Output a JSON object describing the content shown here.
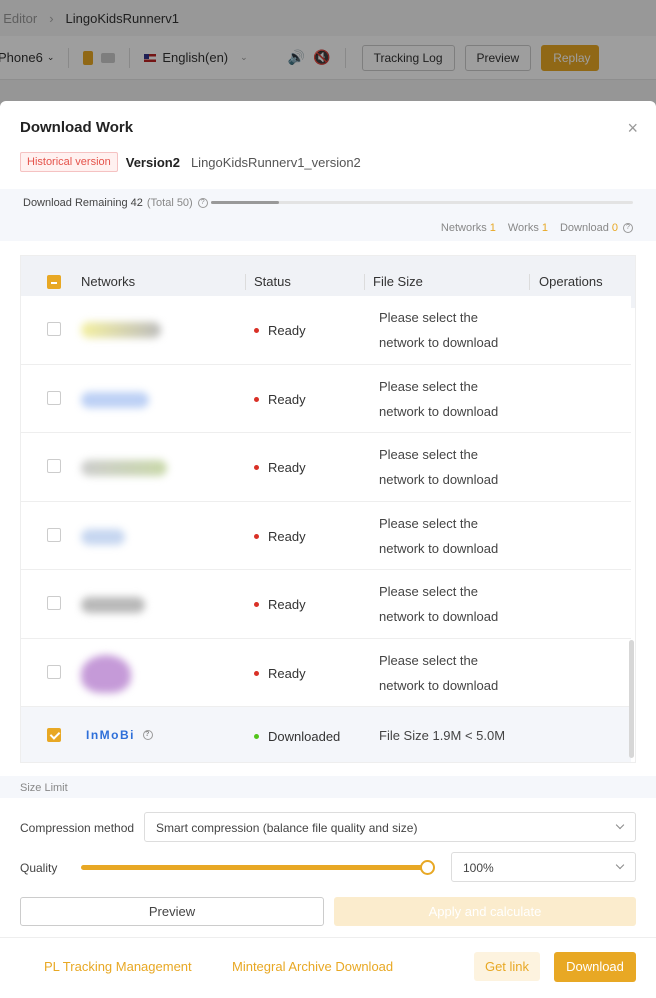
{
  "background": {
    "breadcrumb": {
      "prev": "t Editor",
      "current": "LingoKidsRunnerv1"
    },
    "device": "Phone6",
    "language": "English(en)",
    "buttons": {
      "tracking_log": "Tracking Log",
      "preview": "Preview",
      "replay": "Replay"
    }
  },
  "modal": {
    "title": "Download Work",
    "close_icon": "×",
    "historical_tag": "Historical version",
    "version_name": "Version2",
    "version_file": "LingoKidsRunnerv1_version2",
    "remaining": {
      "label": "Download Remaining 42",
      "total": "(Total 50)",
      "used": 8,
      "limit": 50
    },
    "stats": {
      "networks_label": "Networks",
      "networks_value": "1",
      "works_label": "Works",
      "works_value": "1",
      "download_label": "Download",
      "download_value": "0"
    },
    "table": {
      "headers": {
        "networks": "Networks",
        "status": "Status",
        "file_size": "File Size",
        "operations": "Operations"
      },
      "rows": [
        {
          "status": "Ready",
          "file_size": "Please select the network to download",
          "checked": false
        },
        {
          "status": "Ready",
          "file_size": "Please select the network to download",
          "checked": false
        },
        {
          "status": "Ready",
          "file_size": "Please select the network to download",
          "checked": false
        },
        {
          "status": "Ready",
          "file_size": "Please select the network to download",
          "checked": false
        },
        {
          "status": "Ready",
          "file_size": "Please select the network to download",
          "checked": false
        },
        {
          "status": "Ready",
          "file_size": "Please select the network to download",
          "checked": false
        },
        {
          "network": "InMoBi",
          "status": "Downloaded",
          "file_size": "File Size 1.9M < 5.0M",
          "checked": true
        }
      ]
    },
    "size_limit": {
      "section_label": "Size Limit",
      "compression_label": "Compression method",
      "compression_value": "Smart compression (balance file quality and size)",
      "quality_label": "Quality",
      "quality_value": "100%",
      "quality_percent": 100
    },
    "buttons": {
      "preview": "Preview",
      "apply": "Apply and calculate",
      "pl_tracking": "PL Tracking Management",
      "mintegral": "Mintegral Archive Download",
      "get_link": "Get link",
      "download": "Download"
    },
    "colors": {
      "accent": "#e8a824",
      "ready": "#d93026",
      "downloaded": "#52c41a",
      "historical": "#e5534b"
    }
  }
}
